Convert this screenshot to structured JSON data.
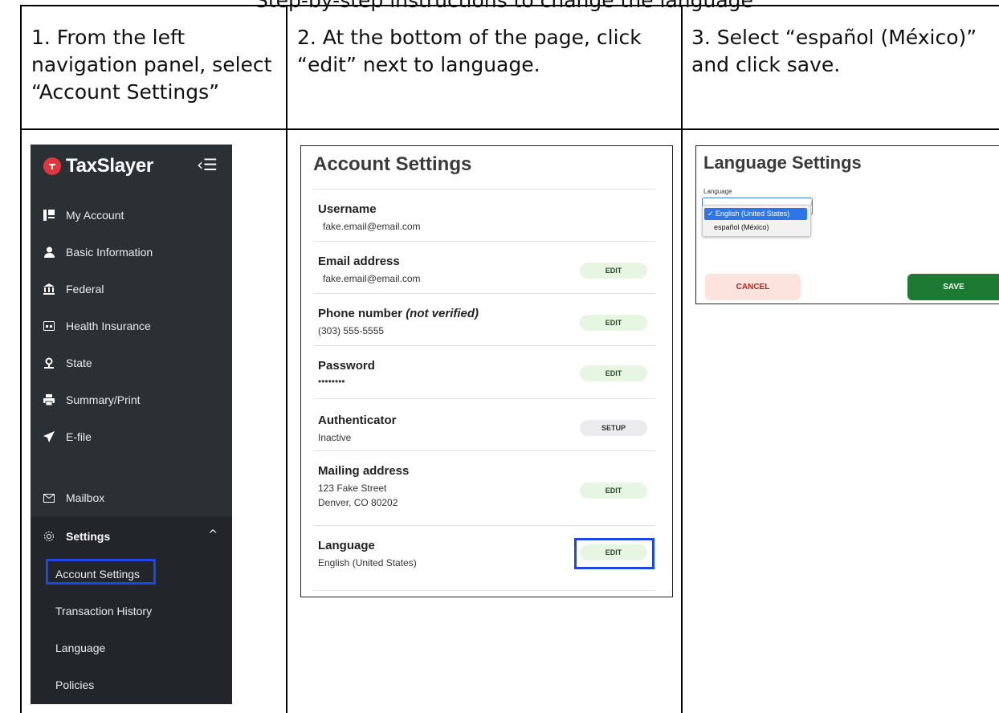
{
  "header_cut_text": "Step-by-step instructions to change the language",
  "steps": [
    {
      "line1": "1. From the left",
      "line2": "navigation panel, select",
      "line3": "“Account Settings”"
    },
    {
      "line1": "2. At the bottom of the page, click",
      "line2": "“edit” next to language.",
      "line3": ""
    },
    {
      "line1": "3. Select “español (México)”",
      "line2": "and click save.",
      "line3": ""
    }
  ],
  "sidebar": {
    "brand": "TaxSlayer",
    "items": [
      {
        "label": "My Account",
        "icon": "account-icon"
      },
      {
        "label": "Basic Information",
        "icon": "person-icon"
      },
      {
        "label": "Federal",
        "icon": "bank-icon"
      },
      {
        "label": "Health Insurance",
        "icon": "card-icon"
      },
      {
        "label": "State",
        "icon": "map-pin-icon"
      },
      {
        "label": "Summary/Print",
        "icon": "printer-icon"
      },
      {
        "label": "E-file",
        "icon": "send-icon"
      },
      {
        "label": "Mailbox",
        "icon": "mail-icon"
      }
    ],
    "settings": {
      "label": "Settings",
      "sub_items": [
        "Account Settings",
        "Transaction History",
        "Language",
        "Policies"
      ]
    }
  },
  "account": {
    "title": "Account Settings",
    "username": {
      "label": "Username",
      "value": "fake.email@email.com"
    },
    "email": {
      "label": "Email address",
      "value": "fake.email@email.com",
      "button": "EDIT"
    },
    "phone": {
      "label": "Phone number",
      "label_suffix": "(not verified)",
      "value": "(303) 555-5555",
      "button": "EDIT"
    },
    "password": {
      "label": "Password",
      "value": "••••••••",
      "button": "EDIT"
    },
    "authenticator": {
      "label": "Authenticator",
      "value": "Inactive",
      "button": "SETUP"
    },
    "mailing": {
      "label": "Mailing address",
      "line1": "123 Fake Street",
      "line2": "Denver, CO 80202",
      "button": "EDIT"
    },
    "language": {
      "label": "Language",
      "value": "English (United States)",
      "button": "EDIT"
    }
  },
  "language_settings": {
    "title": "Language Settings",
    "field_label": "Language",
    "options": [
      "✓ English (United States)",
      "español (México)"
    ],
    "cancel": "CANCEL",
    "save": "SAVE"
  },
  "colors": {
    "highlight": "#1c46e6",
    "sidebar_bg": "#2b3035",
    "brand_red": "#e0363d",
    "save_green": "#1d7a33",
    "edit_green_bg": "#e6f6e3",
    "cancel_bg": "#fde3de"
  }
}
